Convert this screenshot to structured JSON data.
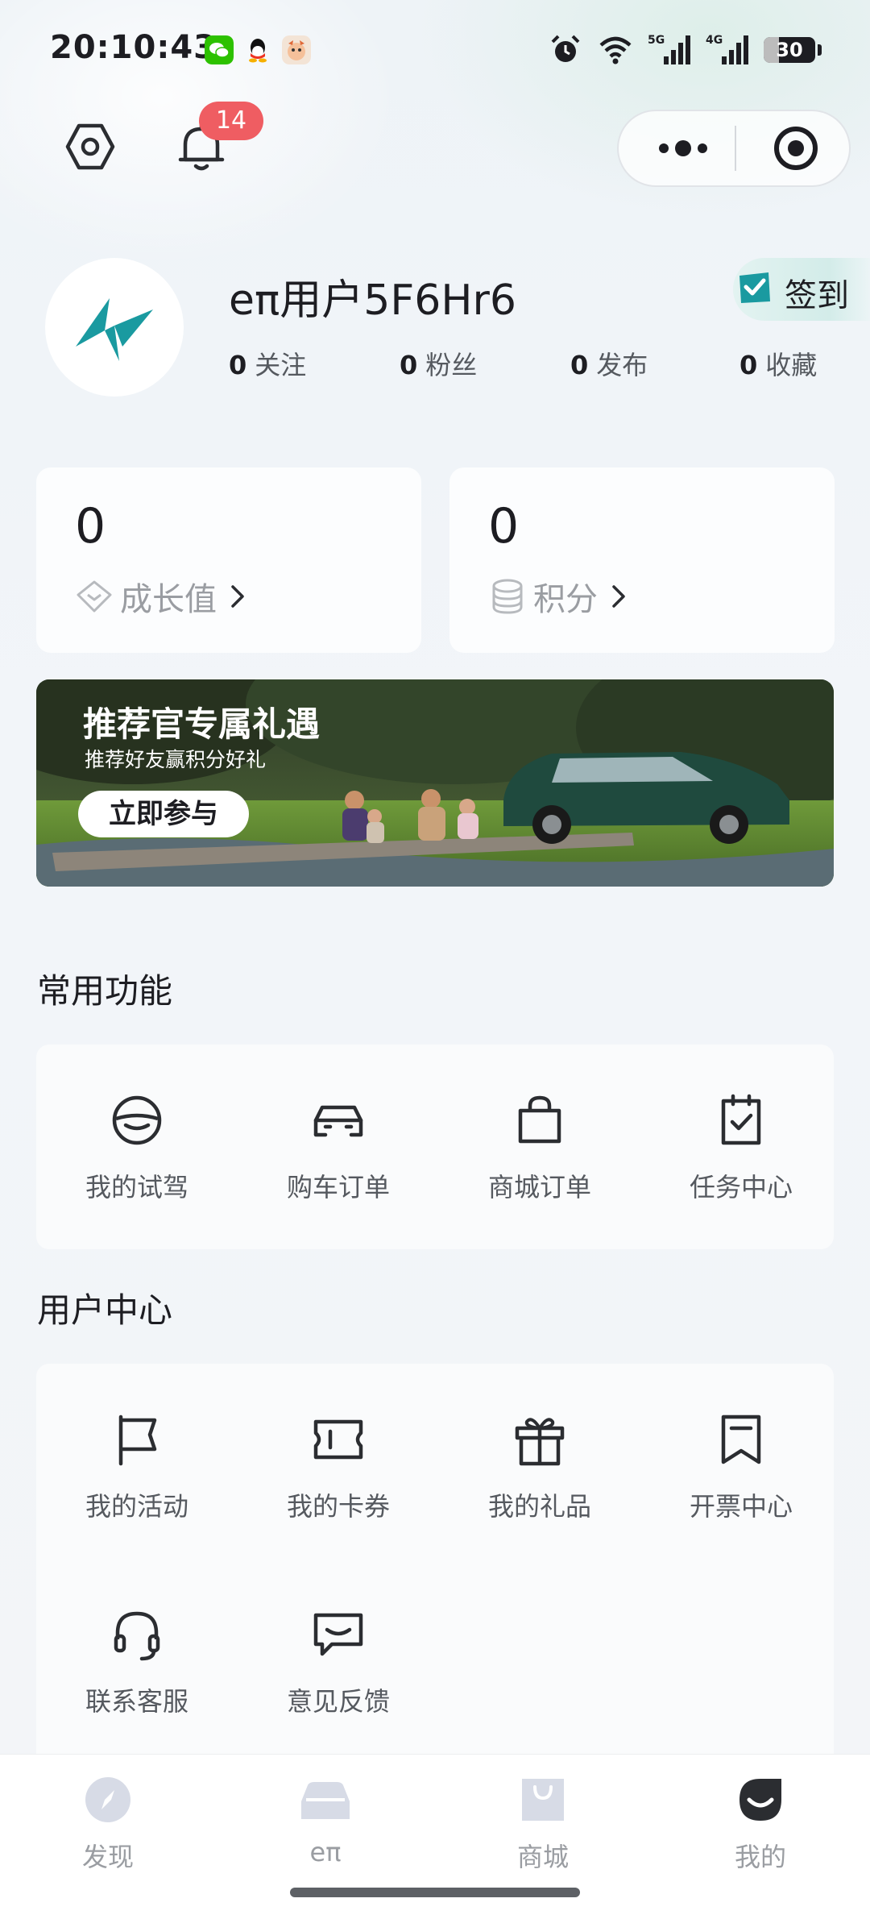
{
  "status_bar": {
    "time": "20:10:43",
    "apps": [
      "wechat-icon",
      "qq-icon",
      "game-icon"
    ],
    "indicators": [
      "alarm-icon",
      "wifi-icon",
      "5g-signal-icon",
      "4g-signal-icon"
    ],
    "battery": "30",
    "battery_level_pct": 30
  },
  "header": {
    "settings_icon": "hexagon-settings-icon",
    "notification_icon": "bell-icon",
    "notification_count": "14",
    "capsule": {
      "more_icon": "more-dots-icon",
      "close_icon": "target-close-icon"
    }
  },
  "profile": {
    "username": "eπ用户5F6Hr6",
    "signin_label": "签到",
    "stats": [
      {
        "value": "0",
        "label": "关注"
      },
      {
        "value": "0",
        "label": "粉丝"
      },
      {
        "value": "0",
        "label": "发布"
      },
      {
        "value": "0",
        "label": "收藏"
      }
    ]
  },
  "cards": [
    {
      "value": "0",
      "label": "成长值",
      "icon": "diamond-icon"
    },
    {
      "value": "0",
      "label": "积分",
      "icon": "coins-icon"
    }
  ],
  "banner": {
    "title": "推荐官专属礼遇",
    "subtitle": "推荐好友赢积分好礼",
    "button": "立即参与"
  },
  "common_functions": {
    "title": "常用功能",
    "items": [
      {
        "label": "我的试驾",
        "icon": "steering-wheel-icon"
      },
      {
        "label": "购车订单",
        "icon": "car-icon"
      },
      {
        "label": "商城订单",
        "icon": "shopping-bag-icon"
      },
      {
        "label": "任务中心",
        "icon": "clipboard-check-icon"
      }
    ]
  },
  "user_center": {
    "title": "用户中心",
    "items": [
      {
        "label": "我的活动",
        "icon": "flag-icon"
      },
      {
        "label": "我的卡券",
        "icon": "ticket-icon"
      },
      {
        "label": "我的礼品",
        "icon": "gift-icon"
      },
      {
        "label": "开票中心",
        "icon": "receipt-icon"
      },
      {
        "label": "联系客服",
        "icon": "headset-icon"
      },
      {
        "label": "意见反馈",
        "icon": "feedback-icon"
      }
    ]
  },
  "bottom_nav": {
    "items": [
      {
        "label": "发现",
        "icon": "compass-icon"
      },
      {
        "label": "eπ",
        "icon": "car-front-icon"
      },
      {
        "label": "商城",
        "icon": "bag-icon"
      },
      {
        "label": "我的",
        "icon": "profile-smile-icon",
        "active": true
      }
    ]
  },
  "colors": {
    "accent_teal": "#1a9aa0",
    "badge_red": "#ef5d62",
    "text_primary": "#1d1d22",
    "text_secondary": "#55595f",
    "text_muted": "#9a9da2"
  }
}
